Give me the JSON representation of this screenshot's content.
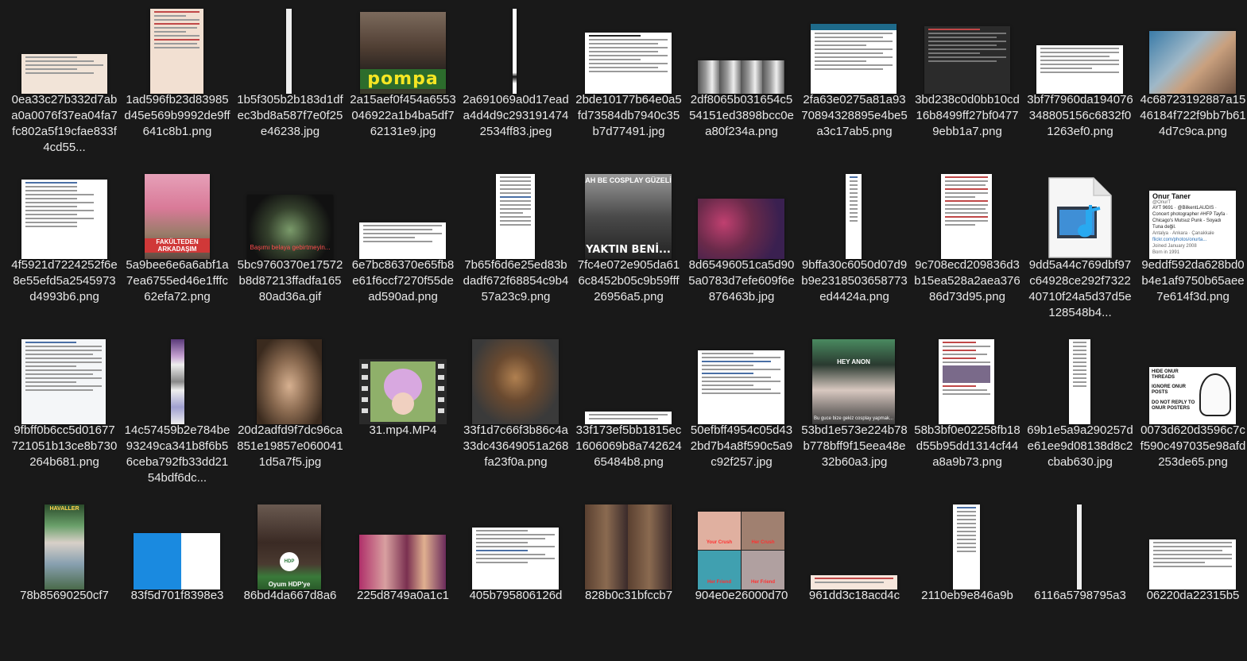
{
  "window": {
    "title": ""
  },
  "colors": {
    "background": "#191919",
    "text": "#e8e8e8"
  },
  "files": [
    {
      "name": "0ea33c27b332d7aba0a0076f37ea04fa7fc802a5f19cfae833f4cd55...",
      "kind": "image"
    },
    {
      "name": "1ad596fb23d83985d45e569b9992de9ff641c8b1.png",
      "kind": "image"
    },
    {
      "name": "1b5f305b2b183d1dfec3bd8a587f7e0f25e46238.jpg",
      "kind": "image"
    },
    {
      "name": "2a15aef0f454a6553046922a1b4ba5df762131e9.jpg",
      "kind": "image",
      "caption": "pompa"
    },
    {
      "name": "2a691069a0d17eada4d4d9c2931914742534ff83.jpeg",
      "kind": "image"
    },
    {
      "name": "2bde10177b64e0a5fd73584db7940c35b7d77491.jpg",
      "kind": "image"
    },
    {
      "name": "2df8065b031654c554151ed3898bcc0ea80f234a.png",
      "kind": "image"
    },
    {
      "name": "2fa63e0275a81a9370894328895e4be5a3c17ab5.png",
      "kind": "image"
    },
    {
      "name": "3bd238c0d0bb10cd16b8499ff27bf04779ebb1a7.png",
      "kind": "image"
    },
    {
      "name": "3bf7f7960da194076348805156c6832f01263ef0.png",
      "kind": "image"
    },
    {
      "name": "4c68723192887a1546184f722f9bb7b614d7c9ca.png",
      "kind": "image"
    },
    {
      "name": "4f5921d7224252f6e8e55efd5a2545973d4993b6.png",
      "kind": "image"
    },
    {
      "name": "5a9bee6e6a6abf1a7ea6755ed46e1fffc62efa72.png",
      "kind": "image",
      "caption": "FAKÜLTEDEN ARKADAŞIM"
    },
    {
      "name": "5bc9760370e17572b8d87213ffadfa16580ad36a.gif",
      "kind": "image",
      "caption": "Başımı belaya gebirtmeyin..."
    },
    {
      "name": "6e7bc86370e65fb8e61f6ccf7270f55dead590ad.png",
      "kind": "image"
    },
    {
      "name": "7b65f6d6e25ed83bdadf672f68854c9b457a23c9.png",
      "kind": "image"
    },
    {
      "name": "7fc4e072e905da616c8452b05c9b59fff26956a5.png",
      "kind": "image",
      "caption_top": "AH BE COSPLAY GÜZELİ",
      "caption": "YAKTIN BENİ..."
    },
    {
      "name": "8d65496051ca5d905a0783d7efe609f6e876463b.jpg",
      "kind": "image"
    },
    {
      "name": "9bffa30c6050d07d9b9e2318503658773ed4424a.png",
      "kind": "image"
    },
    {
      "name": "9c708ecd209836d3b15ea528a2aea37686d73d95.png",
      "kind": "image"
    },
    {
      "name": "9dd5a44c769dbf97c64928ce292f732240710f24a5d37d5e128548b4...",
      "kind": "video"
    },
    {
      "name": "9eddf592da628bd0b4e1af9750b65aee7e614f3d.png",
      "kind": "image",
      "profile_name": "Onur Taner",
      "profile_handle": "@OnurT",
      "profile_lines": [
        "AYT 9691 · @BilkentLAUDIS · Concert photographer #HFP Tayfa · Chicago's Mutsuz Punk - Soyadı Tuna değil.",
        "Antalya · Ankara · Çanakkale",
        "flickr.com/photos/onurta...",
        "Joined January 2008",
        "Born in 1991"
      ]
    },
    {
      "name": "9fbff0b6cc5d01677721051b13ce8b730264b681.png",
      "kind": "image"
    },
    {
      "name": "14c57459b2e784be93249ca341b8f6b56ceba792fb33dd2154bdf6dc...",
      "kind": "image"
    },
    {
      "name": "20d2adfd9f7dc96ca851e19857e0600411d5a7f5.jpg",
      "kind": "image"
    },
    {
      "name": "31.mp4.MP4",
      "kind": "film"
    },
    {
      "name": "33f1d7c66f3b86c4a33dc43649051a268fa23f0a.png",
      "kind": "image"
    },
    {
      "name": "33f173ef5bb1815ec1606069b8a74262465484b8.png",
      "kind": "image"
    },
    {
      "name": "50efbff4954c05d432bd7b4a8f590c5a9c92f257.jpg",
      "kind": "image"
    },
    {
      "name": "53bd1e573e224b78b778bff9f15eea48e32b60a3.jpg",
      "kind": "image",
      "caption_top": "HEY ANON",
      "caption": "Bu guce bize gekiz cosplay yapmak..."
    },
    {
      "name": "58b3bf0e02258fb18d55b95dd1314cf44a8a9b73.png",
      "kind": "image"
    },
    {
      "name": "69b1e5a9a290257de61ee9d08138d8c2cbab630.jpg",
      "kind": "image"
    },
    {
      "name": "0073d620d3596c7cf590c497035e98afd253de65.png",
      "kind": "image",
      "meme_lines": [
        "HIDE ONUR THREADS",
        "IGNORE ONUR POSTS",
        "DO NOT REPLY TO ONUR POSTERS"
      ]
    },
    {
      "name": "78b85690250cf7",
      "kind": "image",
      "caption_top": "HAVALLER"
    },
    {
      "name": "83f5d701f8398e3",
      "kind": "image"
    },
    {
      "name": "86bd4da667d8a6",
      "kind": "image",
      "caption": "Oyum HDP'ye",
      "badge": "HDP"
    },
    {
      "name": "225d8749a0a1c1",
      "kind": "image"
    },
    {
      "name": "405b795806126d",
      "kind": "image"
    },
    {
      "name": "828b0c31bfccb7",
      "kind": "image"
    },
    {
      "name": "904e0e26000d70",
      "kind": "image",
      "captions": [
        "Your Crush",
        "Her Crush",
        "Her Friend",
        "Her Friend"
      ]
    },
    {
      "name": "961dd3c18acd4c",
      "kind": "image"
    },
    {
      "name": "2110eb9e846a9b",
      "kind": "image"
    },
    {
      "name": "6116a5798795a3",
      "kind": "image"
    },
    {
      "name": "06220da22315b5",
      "kind": "image"
    }
  ]
}
